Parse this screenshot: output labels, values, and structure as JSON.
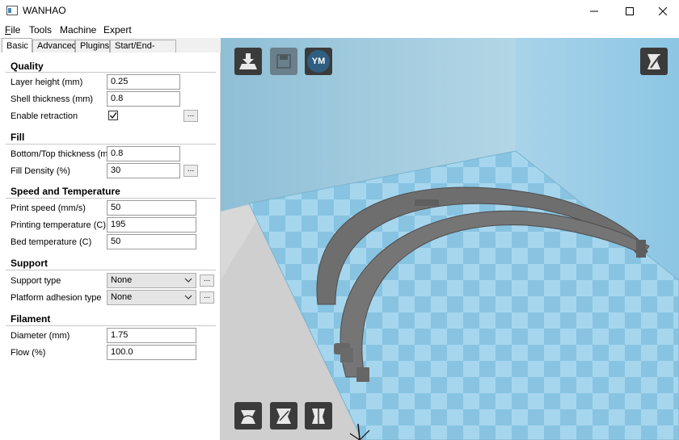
{
  "window": {
    "title": "WANHAO"
  },
  "menu": [
    {
      "label": "File",
      "underline": "F",
      "rest": "ile"
    },
    {
      "label": "Tools",
      "underline": "",
      "rest": "Tools"
    },
    {
      "label": "Machine",
      "underline": "",
      "rest": "Machine"
    },
    {
      "label": "Expert",
      "underline": "",
      "rest": "Expert"
    }
  ],
  "tabs": [
    "Basic",
    "Advanced",
    "Plugins",
    "Start/End-GCode"
  ],
  "quality": {
    "heading": "Quality",
    "layer_height_label": "Layer height (mm)",
    "layer_height": "0.25",
    "shell_thickness_label": "Shell thickness (mm)",
    "shell_thickness": "0.8",
    "retraction_label": "Enable retraction",
    "retraction_checked": true
  },
  "fill": {
    "heading": "Fill",
    "bottom_top_label": "Bottom/Top thickness (mm)",
    "bottom_top": "0.8",
    "density_label": "Fill Density (%)",
    "density": "30"
  },
  "speed": {
    "heading": "Speed and Temperature",
    "print_speed_label": "Print speed (mm/s)",
    "print_speed": "50",
    "print_temp_label": "Printing temperature (C)",
    "print_temp": "195",
    "bed_temp_label": "Bed temperature (C)",
    "bed_temp": "50"
  },
  "support": {
    "heading": "Support",
    "type_label": "Support type",
    "type": "None",
    "adhesion_label": "Platform adhesion type",
    "adhesion": "None"
  },
  "filament": {
    "heading": "Filament",
    "diameter_label": "Diameter (mm)",
    "diameter": "1.75",
    "flow_label": "Flow (%)",
    "flow": "100.0"
  },
  "toolbar": {
    "ym_label": "YM"
  },
  "dots_label": "...",
  "colors": {
    "wall": "#a9cee0",
    "bed_light": "#a6d6ee",
    "bed_dark": "#86c3e0",
    "model": "#6e6e6e",
    "button": "#3b3b3b"
  }
}
